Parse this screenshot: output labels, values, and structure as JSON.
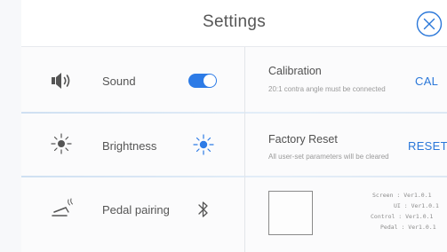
{
  "header": {
    "title": "Settings"
  },
  "sound": {
    "label": "Sound",
    "icon": "speaker-icon",
    "enabled": true
  },
  "brightness": {
    "label": "Brightness",
    "icon": "sun-icon"
  },
  "pedal": {
    "label": "Pedal pairing",
    "icon": "pedal-icon",
    "bluetooth_icon": "bluetooth-icon"
  },
  "calibration": {
    "title": "Calibration",
    "subtitle": "20:1 contra angle must be connected",
    "button": "CAL"
  },
  "factory_reset": {
    "title": "Factory Reset",
    "subtitle": "All user-set parameters will be cleared",
    "button": "RESET"
  },
  "versions": {
    "screen": "Screen : Ver1.0.1",
    "ui": "UI : Ver1.0.1",
    "control": "Control : Ver1.0.1",
    "pedal": "Pedal : Ver1.0.1"
  },
  "colors": {
    "accent": "#2a77d9",
    "toggle_on": "#2d7be6",
    "text": "#555555"
  }
}
